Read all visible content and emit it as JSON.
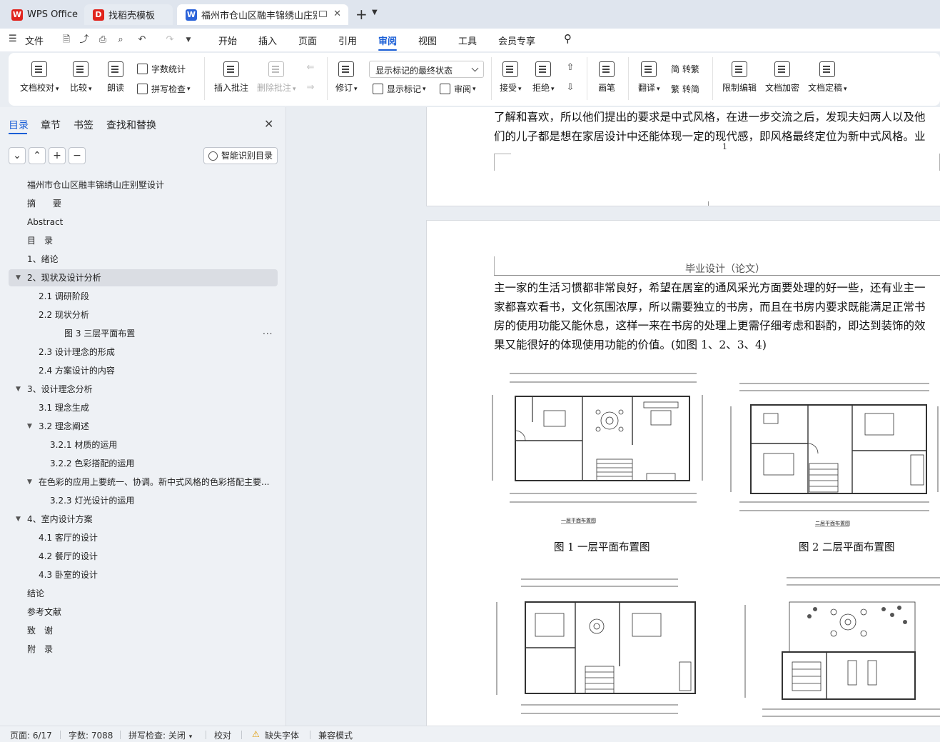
{
  "tabs": [
    {
      "label": "WPS Office",
      "logo": "W",
      "logo_color": "#e0241d"
    },
    {
      "label": "找稻壳模板",
      "logo": "D",
      "logo_color": "#e0241d"
    },
    {
      "label": "福州市仓山区融丰锦绣山庄别墅",
      "logo": "W",
      "logo_color": "#2b63d9"
    }
  ],
  "menu": {
    "file": "文件",
    "items": [
      "开始",
      "插入",
      "页面",
      "引用",
      "审阅",
      "视图",
      "工具",
      "会员专享"
    ],
    "active": "审阅"
  },
  "ribbon": {
    "doc_check": "文档校对",
    "compare": "比较",
    "read_aloud": "朗读",
    "word_count": "字数统计",
    "spell_check": "拼写检查",
    "insert_comment": "插入批注",
    "delete_comment": "删除批注",
    "revise": "修订",
    "markup_state": "显示标记的最终状态",
    "show_markup": "显示标记",
    "review": "审阅",
    "accept": "接受",
    "reject": "拒绝",
    "pen": "画笔",
    "translate": "翻译",
    "to_traditional": "简 转繁",
    "to_simplified": "繁 转简",
    "restrict_edit": "限制编辑",
    "encrypt": "文档加密",
    "finalize": "文档定稿"
  },
  "nav": {
    "tabs": [
      "目录",
      "章节",
      "书签",
      "查找和替换"
    ],
    "smart_toc": "智能识别目录",
    "toc": [
      {
        "text": "福州市仓山区融丰锦绣山庄别墅设计",
        "level": 1,
        "expand": ""
      },
      {
        "text": "摘　　要",
        "level": 1,
        "expand": ""
      },
      {
        "text": "Abstract",
        "level": 1,
        "expand": ""
      },
      {
        "text": "目　录",
        "level": 1,
        "expand": ""
      },
      {
        "text": "1、绪论",
        "level": 1,
        "expand": ""
      },
      {
        "text": "2、现状及设计分析",
        "level": 1,
        "expand": "▼",
        "selected": true
      },
      {
        "text": "2.1 调研阶段",
        "level": 2,
        "expand": ""
      },
      {
        "text": "2.2 现状分析",
        "level": 2,
        "expand": ""
      },
      {
        "text": "图 3 三层平面布置",
        "level": 4,
        "expand": ""
      },
      {
        "text": "2.3 设计理念的形成",
        "level": 2,
        "expand": ""
      },
      {
        "text": "2.4 方案设计的内容",
        "level": 2,
        "expand": ""
      },
      {
        "text": "3、设计理念分析",
        "level": 1,
        "expand": "▼"
      },
      {
        "text": "3.1 理念生成",
        "level": 2,
        "expand": ""
      },
      {
        "text": "3.2 理念阐述",
        "level": 2,
        "expand": "▼"
      },
      {
        "text": "3.2.1 材质的运用",
        "level": 3,
        "expand": ""
      },
      {
        "text": "3.2.2 色彩搭配的运用",
        "level": 3,
        "expand": ""
      },
      {
        "text": "在色彩的应用上要统一、协调。新中式风格的色彩搭配主要...",
        "level": 2,
        "expand": "▼"
      },
      {
        "text": "3.2.3 灯光设计的运用",
        "level": 3,
        "expand": ""
      },
      {
        "text": "4、室内设计方案",
        "level": 1,
        "expand": "▼"
      },
      {
        "text": "4.1 客厅的设计",
        "level": 2,
        "expand": ""
      },
      {
        "text": "4.2 餐厅的设计",
        "level": 2,
        "expand": ""
      },
      {
        "text": "4.3 卧室的设计",
        "level": 2,
        "expand": ""
      },
      {
        "text": "结论",
        "level": 1,
        "expand": ""
      },
      {
        "text": "参考文献",
        "level": 1,
        "expand": ""
      },
      {
        "text": "致　谢",
        "level": 1,
        "expand": ""
      },
      {
        "text": "附　录",
        "level": 1,
        "expand": ""
      }
    ],
    "toc_more": "..."
  },
  "doc": {
    "page1_lines": [
      "了解和喜欢，所以他们提出的要求是中式风格，在进一步交流之后，发现夫妇两人以及他",
      "们的儿子都是想在家居设计中还能体现一定的现代感，即风格最终定位为新中式风格。业"
    ],
    "page1_number": "1",
    "page2_header": "毕业设计（论文）",
    "page2_lines": [
      "主一家的生活习惯都非常良好，希望在居室的通风采光方面要处理的好一些，还有业主一",
      "家都喜欢看书，文化氛围浓厚，所以需要独立的书房，而且在书房内要求既能满足正常书",
      "房的使用功能又能休息，这样一来在书房的处理上更需仔细考虑和斟酌，即达到装饰的效",
      "果又能很好的体现使用功能的价值。(如图 1、2、3、4)"
    ],
    "figure1_title": "一层平面布置图",
    "figure2_title": "二层平面布置图",
    "caption1": "图 1 一层平面布置图",
    "caption2": "图 2 二层平面布置图"
  },
  "status": {
    "page": "页面: 6/17",
    "words": "字数: 7088",
    "spell": "拼写检查: 关闭",
    "proofread": "校对",
    "missing_font": "缺失字体",
    "compat": "兼容模式"
  }
}
